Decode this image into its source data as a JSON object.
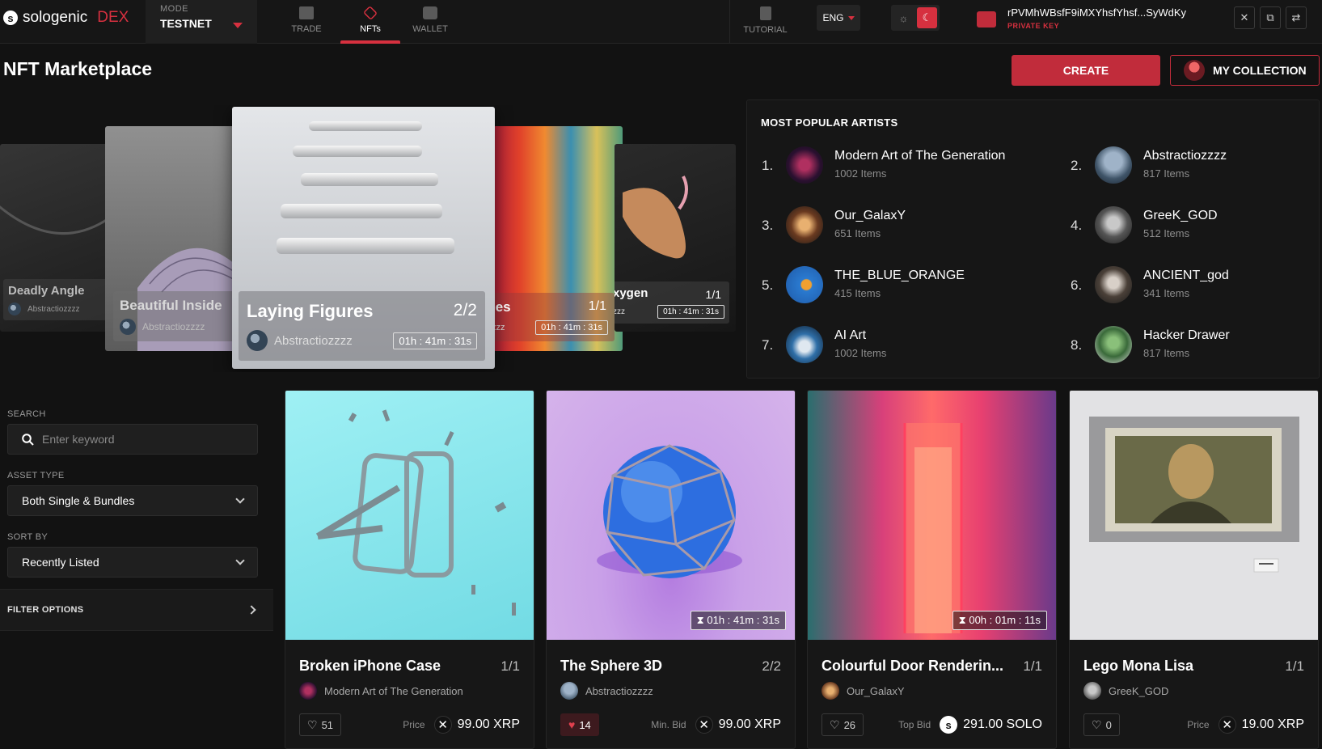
{
  "app": {
    "logo_text": "sologenic",
    "logo_mark": "s",
    "logo_suffix": "DEX"
  },
  "mode": {
    "label": "MODE",
    "value": "TESTNET"
  },
  "nav": {
    "tabs": [
      {
        "label": "TRADE",
        "icon": "chart-grid-icon"
      },
      {
        "label": "NFTs",
        "icon": "nft-hexagon-icon",
        "active": true
      },
      {
        "label": "WALLET",
        "icon": "wallet-icon"
      }
    ],
    "tutorial": "TUTORIAL"
  },
  "language": "ENG",
  "theme": {
    "light_icon": "☼",
    "dark_icon": "☾"
  },
  "wallet": {
    "address": "rPVMhWBsfF9iMXYhsfYhsf...SyWdKy",
    "key_type": "PRIVATE KEY",
    "close_icon": "✕",
    "copy_icon": "⧉",
    "swap_icon": "⇄"
  },
  "page": {
    "title": "NFT Marketplace",
    "create_label": "CREATE",
    "collection_label": "MY COLLECTION"
  },
  "carousel": [
    {
      "title": "Deadly Angle",
      "artist": "Abstractiozzzz"
    },
    {
      "title": "Beautiful Inside",
      "artist": "Abstractiozzzz"
    },
    {
      "title": "Laying Figures",
      "edition": "2/2",
      "artist": "Abstractiozzzz",
      "timer": "01h : 41m : 31s"
    },
    {
      "title": "ies",
      "edition": "1/1",
      "artist": "zzz",
      "timer": "01h : 41m : 31s"
    },
    {
      "title": "xygen",
      "edition": "1/1",
      "artist": "zzz",
      "timer": "01h : 41m : 31s"
    }
  ],
  "popular_artists": {
    "title": "MOST POPULAR ARTISTS",
    "items": [
      {
        "rank": "1.",
        "name": "Modern Art of The Generation",
        "count": "1002 Items"
      },
      {
        "rank": "2.",
        "name": "Abstractiozzzz",
        "count": "817 Items"
      },
      {
        "rank": "3.",
        "name": "Our_GalaxY",
        "count": "651 Items"
      },
      {
        "rank": "4.",
        "name": "GreeK_GOD",
        "count": "512 Items"
      },
      {
        "rank": "5.",
        "name": "THE_BLUE_ORANGE",
        "count": "415 Items"
      },
      {
        "rank": "6.",
        "name": "ANCIENT_god",
        "count": "341 Items"
      },
      {
        "rank": "7.",
        "name": "AI Art",
        "count": "1002 Items"
      },
      {
        "rank": "8.",
        "name": "Hacker Drawer",
        "count": "817 Items"
      }
    ]
  },
  "filters": {
    "search_label": "SEARCH",
    "search_placeholder": "Enter keyword",
    "asset_type_label": "ASSET TYPE",
    "asset_type_value": "Both Single & Bundles",
    "sort_label": "SORT BY",
    "sort_value": "Recently Listed",
    "filter_options_label": "FILTER OPTIONS"
  },
  "nfts": [
    {
      "title": "Broken iPhone Case",
      "edition": "1/1",
      "owner": "Modern Art of The Generation",
      "likes": "51",
      "liked": false,
      "price_label": "Price",
      "price": "99.00 XRP",
      "currency": "XRP"
    },
    {
      "title": "The Sphere 3D",
      "edition": "2/2",
      "owner": "Abstractiozzzz",
      "likes": "14",
      "liked": true,
      "price_label": "Min. Bid",
      "price": "99.00 XRP",
      "currency": "XRP",
      "timer": "01h : 41m : 31s"
    },
    {
      "title": "Colourful Door Renderin...",
      "edition": "1/1",
      "owner": "Our_GalaxY",
      "likes": "26",
      "liked": false,
      "price_label": "Top Bid",
      "price": "291.00 SOLO",
      "currency": "SOLO",
      "timer": "00h : 01m : 11s"
    },
    {
      "title": "Lego Mona Lisa",
      "edition": "1/1",
      "owner": "GreeK_GOD",
      "likes": "0",
      "liked": false,
      "price_label": "Price",
      "price": "19.00 XRP",
      "currency": "XRP"
    }
  ],
  "colors": {
    "accent": "#c12c3b",
    "accent_bright": "#d6303f",
    "background": "#121212",
    "panel": "#161616"
  }
}
